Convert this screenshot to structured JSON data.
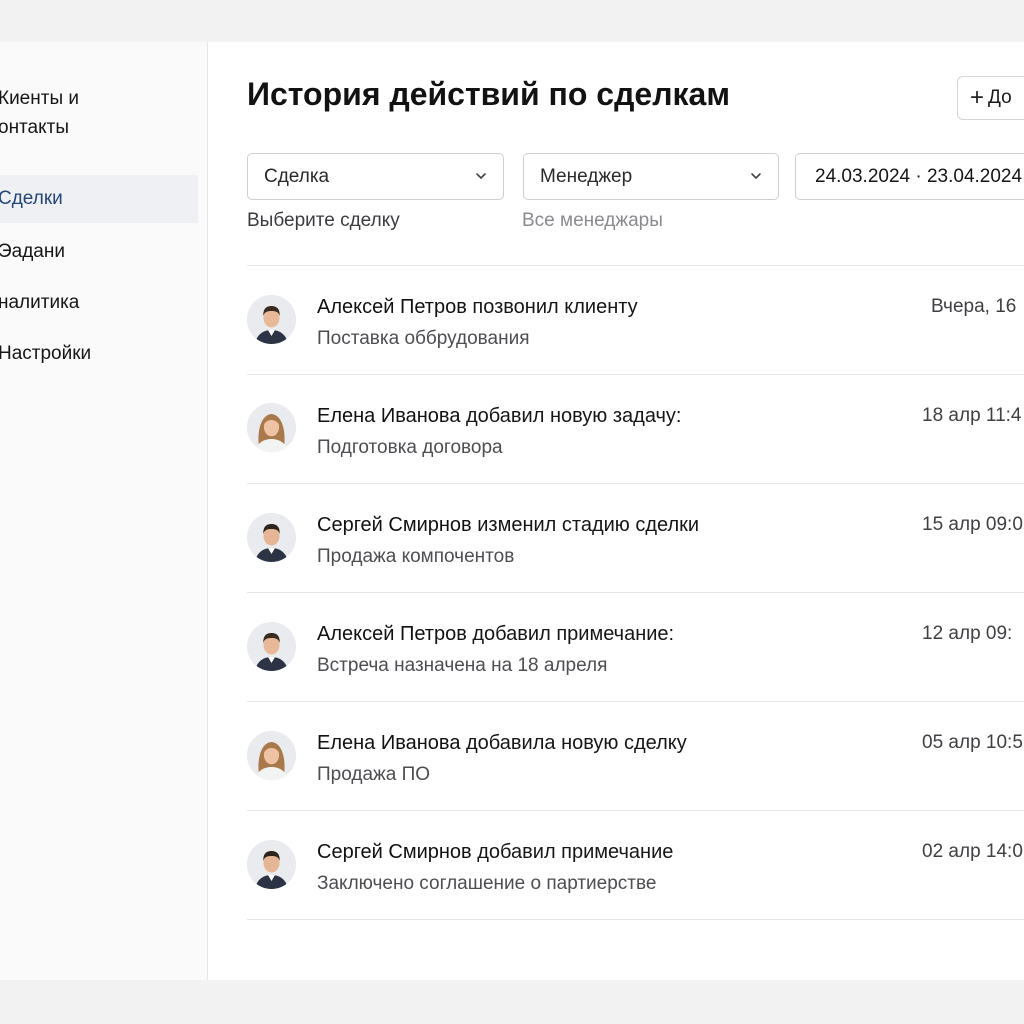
{
  "sidebar": {
    "items": [
      {
        "label_line1": "Киенты и",
        "label_line2": "онтакты",
        "active": false
      },
      {
        "label": "Сделки",
        "active": true
      },
      {
        "label": "Эадани",
        "active": false
      },
      {
        "label": "налитика",
        "active": false
      },
      {
        "label": "Настройки",
        "active": false
      }
    ]
  },
  "header": {
    "title": "История действий по сделкам",
    "add_button_label": "До"
  },
  "filters": {
    "deal": {
      "value": "Сделка",
      "hint": "Выберите сделку"
    },
    "manager": {
      "value": "Менеджер",
      "hint": "Все менеджары"
    },
    "date_range": {
      "value": "24.03.2024 · 23.04.2024"
    }
  },
  "colors": {
    "accent": "#24467a",
    "active_bg": "#eef0f3",
    "border": "#e6e6e8"
  },
  "activities": [
    {
      "actor": "Алексей Петров",
      "action": " позвонил клиенту",
      "subtitle": "Поставка оббрудования",
      "time": "Вчера, 16",
      "avatar": "male-avatar"
    },
    {
      "actor": "Елена Иванова",
      "action": " добавил новую задачу:",
      "subtitle": "Подготовка договора",
      "time": "18 алр 11:4",
      "avatar": "female-avatar"
    },
    {
      "actor": "Сергей Смирнов",
      "action": " изменил стадию сделки",
      "subtitle": "Продажа компочентов",
      "time": "15 алр 09:0",
      "avatar": "male-avatar"
    },
    {
      "actor": "Алексей Петров",
      "action": " добавил примечание:",
      "subtitle": "Встреча назначена на 18 алреля",
      "time": "12 алр 09:",
      "avatar": "male-avatar"
    },
    {
      "actor": "Елена Иванова",
      "action": " добавила новую сделку",
      "subtitle": "Продажа ПО",
      "time": "05 алр 10:5",
      "avatar": "female-avatar"
    },
    {
      "actor": "Сергей Смирнов",
      "action": " добавил примечание",
      "subtitle": "Заключено соглашение о партиерстве",
      "time": "02 алр 14:0",
      "avatar": "male-avatar"
    }
  ]
}
